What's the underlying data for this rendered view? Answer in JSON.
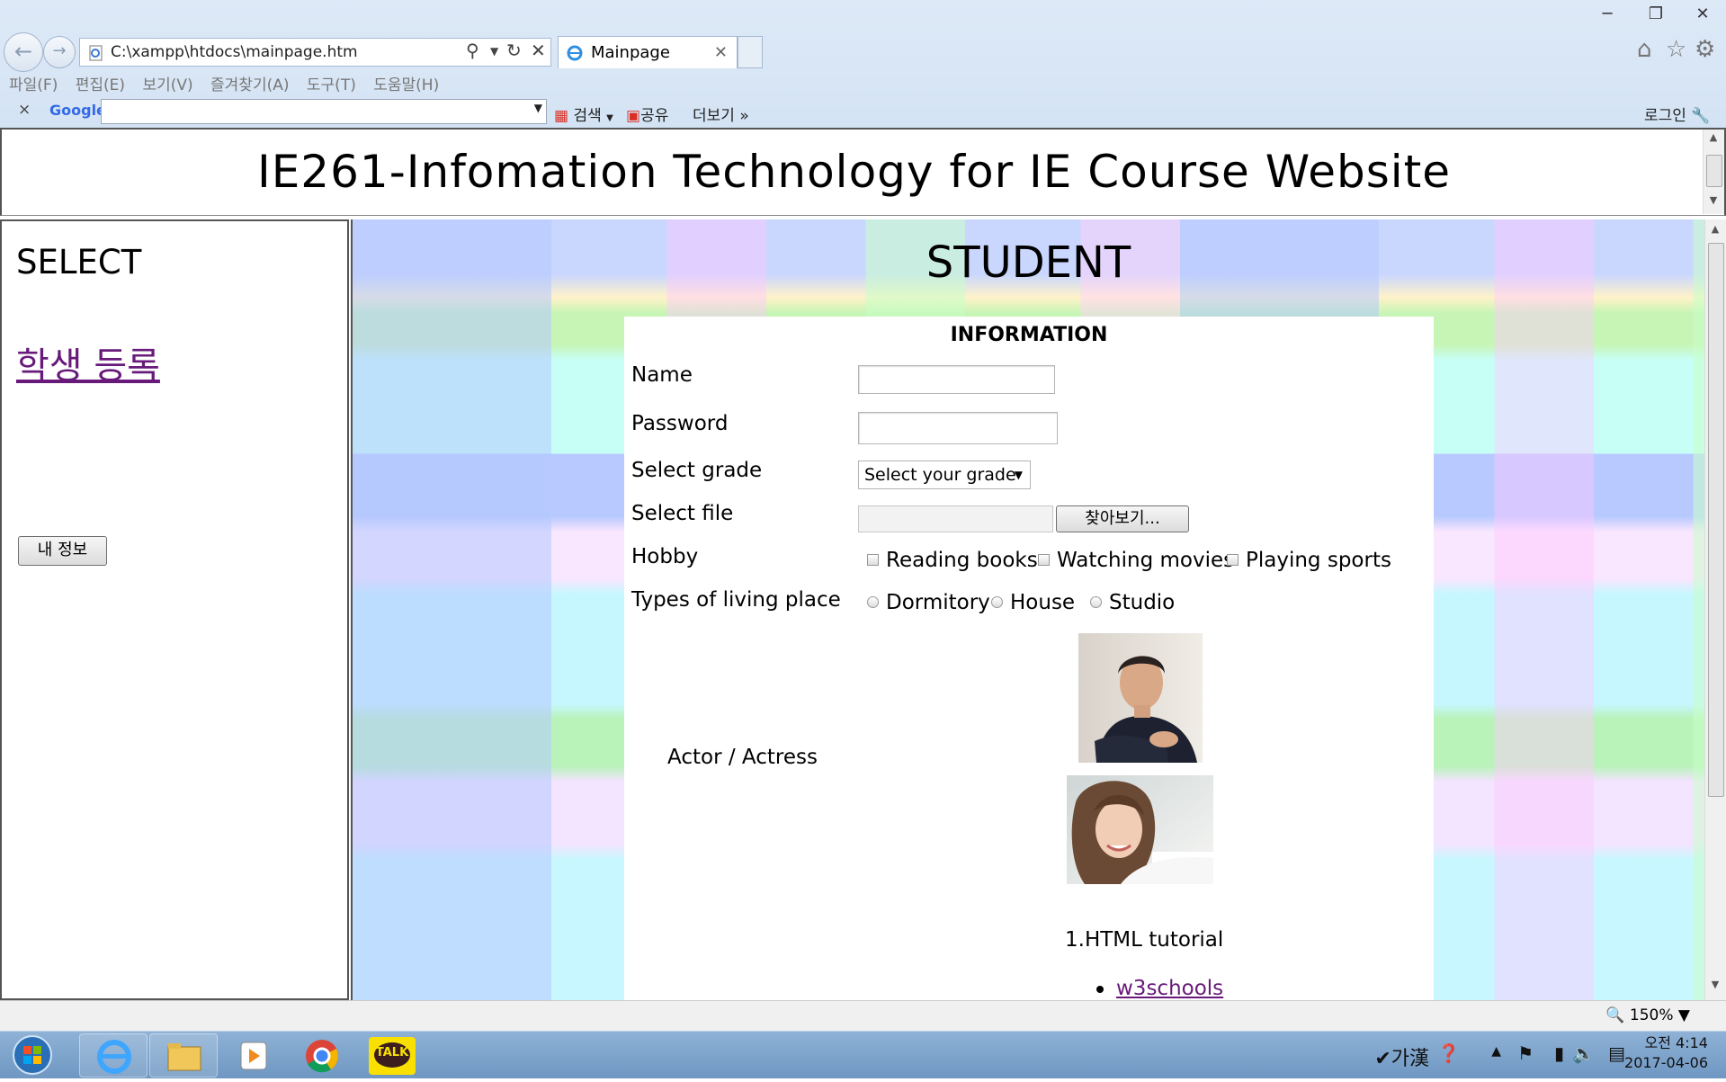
{
  "browser": {
    "address": "C:\\xampp\\htdocs\\mainpage.htm",
    "tab_title": "Mainpage",
    "menu": [
      "파일(F)",
      "편집(E)",
      "보기(V)",
      "즐겨찾기(A)",
      "도구(T)",
      "도움말(H)"
    ],
    "google_bar": {
      "logo": "Google",
      "search_label": "검색",
      "share_label": "공유",
      "more_label": "더보기",
      "login_label": "로그인"
    },
    "zoom": "150%"
  },
  "page": {
    "site_title": "IE261-Infomation Technology for IE Course Website",
    "left": {
      "title": "SELECT",
      "register_link": "학생 등록",
      "myinfo_button": "내 정보"
    },
    "main": {
      "title": "STUDENT",
      "form_heading": "INFORMATION",
      "labels": {
        "name": "Name",
        "password": "Password",
        "grade": "Select grade",
        "file": "Select file",
        "hobby": "Hobby",
        "living": "Types of living place",
        "actor": "Actor / Actress"
      },
      "grade_placeholder": "Select your grade",
      "file_button": "찾아보기...",
      "hobbies": [
        "Reading books",
        "Watching movies",
        "Playing sports"
      ],
      "living_places": [
        "Dormitory",
        "House",
        "Studio"
      ],
      "tutorial_title": "1.HTML tutorial",
      "tutorial_link": "w3schools"
    }
  },
  "taskbar": {
    "ime": "가漢",
    "time": "오전 4:14",
    "date": "2017-04-06",
    "kakao": "TALK"
  }
}
